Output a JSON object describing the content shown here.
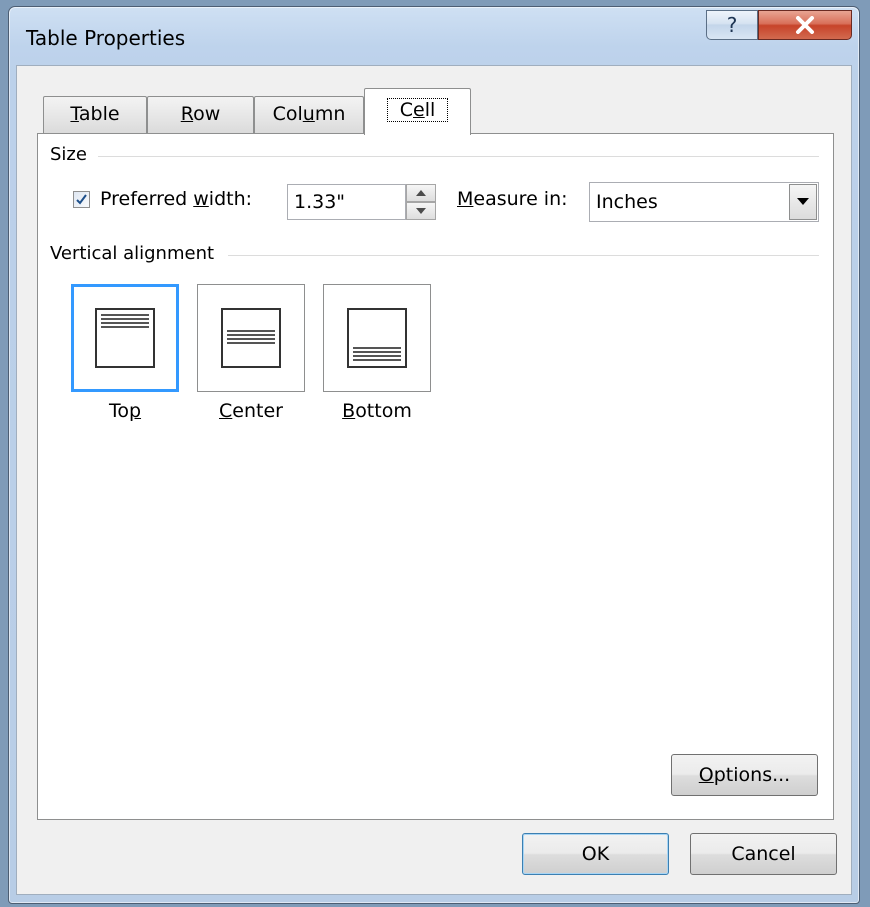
{
  "window": {
    "title": "Table Properties",
    "help_glyph": "?",
    "close_glyph": "X"
  },
  "tabs": [
    {
      "pre": "",
      "key": "T",
      "post": "able",
      "active": false
    },
    {
      "pre": "",
      "key": "R",
      "post": "ow",
      "active": false
    },
    {
      "pre": "Col",
      "key": "u",
      "post": "mn",
      "active": false
    },
    {
      "pre": "C",
      "key": "e",
      "post": "ll",
      "active": true
    }
  ],
  "size_group": {
    "title": "Size",
    "preferred_width": {
      "checked": true,
      "label_pre": "Preferred ",
      "label_key": "w",
      "label_post": "idth:",
      "value": "1.33\""
    },
    "measure_in": {
      "label_key": "M",
      "label_post": "easure in:",
      "value": "Inches"
    }
  },
  "alignment_group": {
    "title": "Vertical alignment",
    "options": [
      {
        "pre": "To",
        "key": "p",
        "post": "",
        "selected": true,
        "icon": "align-top-icon"
      },
      {
        "pre": "",
        "key": "C",
        "post": "enter",
        "selected": false,
        "icon": "align-center-icon"
      },
      {
        "pre": "",
        "key": "B",
        "post": "ottom",
        "selected": false,
        "icon": "align-bottom-icon"
      }
    ]
  },
  "buttons": {
    "options": {
      "key": "O",
      "post": "ptions..."
    },
    "ok": "OK",
    "cancel": "Cancel"
  },
  "colors": {
    "focus_border": "#3399ff",
    "close_red": "#c7432a"
  }
}
